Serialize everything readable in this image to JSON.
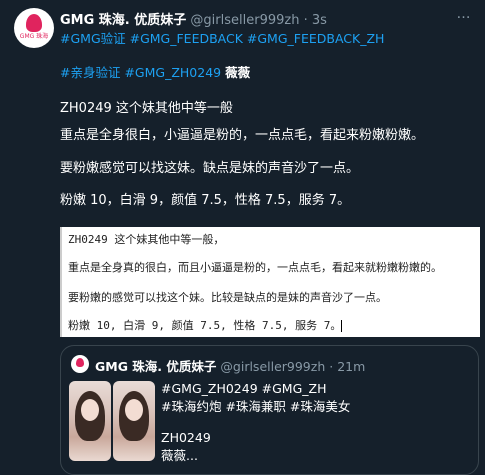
{
  "tweet": {
    "avatar_text": "GMG 珠海",
    "display_name": "GMG 珠海. 优质妹子",
    "handle": "@girlseller999zh",
    "separator": "·",
    "time": "3s",
    "more_icon": "…",
    "hashtags_line1": "#GMG验证 #GMG_FEEDBACK #GMG_FEEDBACK_ZH",
    "hashtags_line2_links": "#亲身验证 #GMG_ZH0249",
    "hashtags_line2_name": "薇薇",
    "body": [
      "ZH0249 这个妹其他中等一般",
      "重点是全身很白，小逼逼是粉的，一点点毛，看起来粉嫩粉嫩。",
      "要粉嫩感觉可以找这妹。缺点是妹的声音沙了一点。",
      "粉嫩 10，白滑 9，颜值 7.5，性格 7.5，服务 7。"
    ]
  },
  "attached_image": {
    "lines": [
      "ZH0249 这个妹其他中等一般，",
      "重点是全身真的很白，而且小逼逼是粉的，一点点毛，看起来就粉嫩粉嫩的。",
      "要粉嫩的感觉可以找这个妹。比较是缺点的是妹的声音沙了一点。",
      "粉嫩 10, 白滑 9, 颜值 7.5, 性格 7.5, 服务 7。"
    ]
  },
  "quoted": {
    "display_name": "GMG 珠海. 优质妹子",
    "handle": "@girlseller999zh",
    "separator": "·",
    "time": "21m",
    "lines": [
      "#GMG_ZH0249 #GMG_ZH",
      "#珠海约炮 #珠海兼职 #珠海美女",
      "ZH0249",
      "薇薇..."
    ]
  },
  "colors": {
    "background": "#15202b",
    "link": "#1da1f2",
    "muted": "#8899a6",
    "brand": "#e0245e"
  }
}
